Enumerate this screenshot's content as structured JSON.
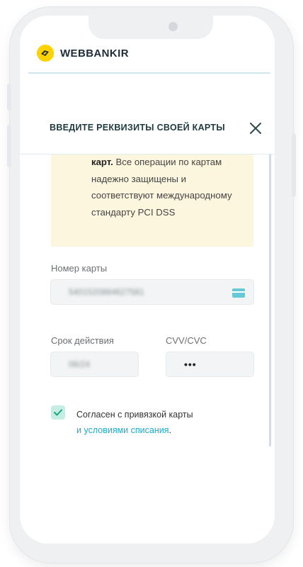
{
  "brand": {
    "name": "WEBBANKIR",
    "logo_color": "#ffd200"
  },
  "modal": {
    "title": "ВВЕДИТЕ РЕКВИЗИТЫ СВОЕЙ КАРТЫ",
    "close_icon": "close-icon"
  },
  "info": {
    "bold": "карт.",
    "text": " Все операции по картам надежно защищены и соответствуют международному стандарту PCI DSS"
  },
  "form": {
    "card_number_label": "Номер карты",
    "card_number_value": "5401520884627581",
    "expiry_label": "Срок действия",
    "expiry_value": "06/24",
    "cvv_label": "CVV/CVC",
    "cvv_value": "•••"
  },
  "agreement": {
    "checked": true,
    "text": "Согласен с привязкой карты",
    "link_text": "и условиями списания",
    "suffix": "."
  },
  "colors": {
    "accent": "#18aecb",
    "check_bg": "#c6ede4",
    "info_bg": "#fdf6de"
  }
}
